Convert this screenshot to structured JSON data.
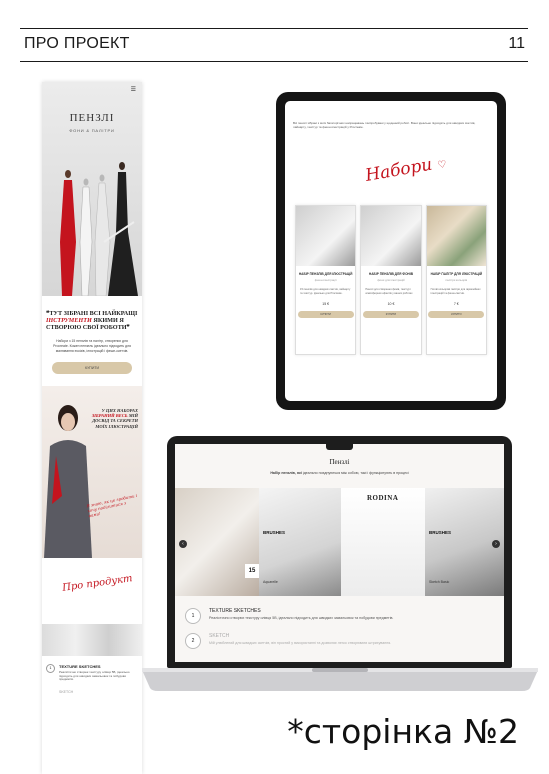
{
  "header": {
    "title": "ПРО ПРОЕКТ",
    "page_number": "11"
  },
  "phone": {
    "menu_icon": "menu-icon",
    "brand": "ПЕНЗЛІ",
    "brand_sub": "ФОНИ & ПАЛІТРИ",
    "quote_start": "❝ТУТ ЗІБРАНІ ВСІ НАЙКРАЩІ ",
    "quote_highlight": "ІНСТРУМЕНТИ",
    "quote_end": " ЯКИМИ Я СТВОРЮЮ СВОЇ РОБОТИ❞",
    "description": "Набори з 15 пензлів та палітр, створених для Procreate. Кожен пензель ідеально підходить для малювання ескізів, ілюстрацій і фешн-скетчів.",
    "button_label": "КУПИТИ",
    "promo_start": "У ЦИХ НАБОРАХ ",
    "promo_highlight": "ЗІБРАНИЙ ВЕСЬ",
    "promo_end": " МІЙ ДОСВІД ТА СЕКРЕТИ МОЇХ ІЛЮСТРАЦІЙ",
    "handwritten_note": "Я знаю, як це зробити і хочу поділитися з вами!",
    "signature": "Про продукт",
    "item1_title": "TEXTURE SKETCHES",
    "item1_desc": "Реалістично створює текстуру олівця 5В, ідеально підходить для швидких замальовок та побудови предметів.",
    "item2_title": "SKETCH"
  },
  "tablet": {
    "intro": "Всі пензлі зібрані з моїх багаторічних напрацювань і випробувані у щоденній роботі. Вони ідеально підходять для швидких скетчів, лайнарту, текстур та фешн-ілюстрацій у Procreate.",
    "signature": "Набори",
    "cards": [
      {
        "title": "НАБІР ПЕНЗЛІВ ДЛЯ ІЛЮСТРАЦІЙ",
        "sub": "фешн-ілюстрації",
        "text": "15 пензлів для швидких скетчів, лайнарту та текстур. Ідеально для Procreate.",
        "price": "15 €",
        "button": "КУПИТИ"
      },
      {
        "title": "НАБІР ПЕНЗЛІВ ДЛЯ ФОНІВ",
        "sub": "фони для ілюстрацій",
        "text": "Пензлі для створення фонів, текстур і атмосферних ефектів у ваших роботах.",
        "price": "10 €",
        "button": "КУПИТИ"
      },
      {
        "title": "НАБІР ПАЛІТР ДЛЯ ІЛЮСТРАЦІЙ",
        "sub": "палітри кольорів",
        "text": "Готові кольорові палітри для гармонійних ілюстрацій та фешн-скетчів.",
        "price": "7 €",
        "button": "КУПИТИ"
      }
    ]
  },
  "laptop": {
    "title": "Пензлі",
    "caption_bold": "Набір пензлів, які",
    "caption_rest": " ідеально поєднуються між собою, такі і функціонують в процесі",
    "brushes_label_1": "BRUSHES",
    "brushes_label_2": "BRUSHES",
    "rodina": "RODINA",
    "count_badge": "15",
    "tile_watercolor": "Aquarelle",
    "tile_sketch": "Sketch Basic",
    "item1_num": "1",
    "item1_title": "TEXTURE SKETCHES",
    "item1_desc": "Реалістично створює текстуру олівця 5В, ідеально підходить для швидких замальовок та побудови предметів.",
    "item2_num": "2",
    "item2_title": "SKETCH",
    "item2_desc": "Мій улюблений для швидких скетчів, він простий у використанні та дозволяє легко створювати штрихування."
  },
  "footnote": "*сторінка №2",
  "colors": {
    "accent_red": "#c4141e",
    "button_beige": "#d8c8a8",
    "rule": "#1a1a1a"
  }
}
